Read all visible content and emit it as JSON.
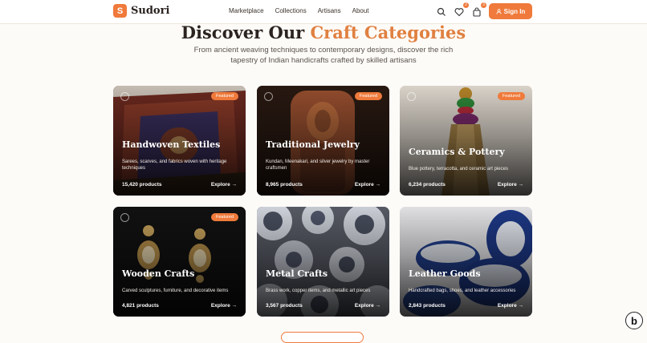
{
  "brand": {
    "initial": "S",
    "name": "Sudori"
  },
  "nav": {
    "links": [
      "Marketplace",
      "Collections",
      "Artisans",
      "About"
    ],
    "wishlist_count": "2",
    "cart_count": "3",
    "signin_label": "Sign In"
  },
  "hero": {
    "title_plain": "Discover Our ",
    "title_accent": "Craft Categories",
    "subtitle": "From ancient weaving techniques to contemporary designs, discover the rich tapestry of Indian handicrafts crafted by skilled artisans"
  },
  "categories": [
    {
      "title": "Handwoven Textiles",
      "description": "Sarees, scarves, and fabrics woven with heritage techniques",
      "count": "15,420 products",
      "explore": "Explore →",
      "badge": "Featured"
    },
    {
      "title": "Traditional Jewelry",
      "description": "Kundan, Meenakari, and silver jewelry by master craftsmen",
      "count": "8,965 products",
      "explore": "Explore →",
      "badge": "Featured"
    },
    {
      "title": "Ceramics & Pottery",
      "description": "Blue pottery, terracotta, and ceramic art pieces",
      "count": "6,234 products",
      "explore": "Explore →",
      "badge": "Featured"
    },
    {
      "title": "Wooden Crafts",
      "description": "Carved sculptures, furniture, and decorative items",
      "count": "4,821 products",
      "explore": "Explore →",
      "badge": "Featured"
    },
    {
      "title": "Metal Crafts",
      "description": "Brass work, copper items, and metallic art pieces",
      "count": "3,567 products",
      "explore": "Explore →"
    },
    {
      "title": "Leather Goods",
      "description": "Handcrafted bags, shoes, and leather accessories",
      "count": "2,843 products",
      "explore": "Explore →"
    }
  ],
  "colors": {
    "accent": "#ef7a3b",
    "title_accent": "#e08040",
    "background": "#fdfbf8"
  }
}
